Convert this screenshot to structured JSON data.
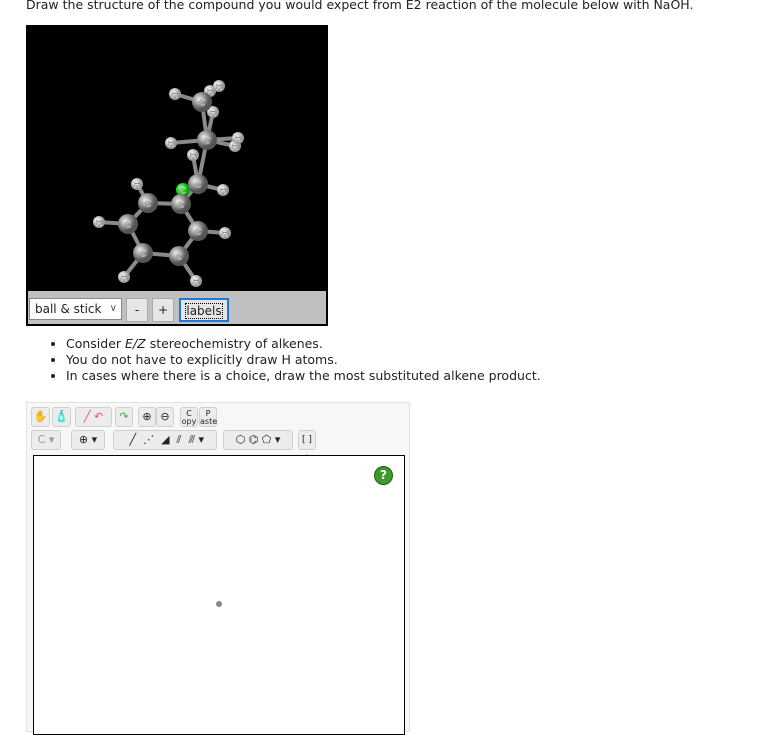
{
  "question": "Draw the structure of the compound you would expect from E2 reaction of the molecule below with NaOH.",
  "viewer": {
    "style_select": "ball & stick",
    "minus": "-",
    "plus": "+",
    "labels": "labels",
    "atom_c": "C",
    "atom_h": "H",
    "halogen_color": "#22c322"
  },
  "bullets": [
    {
      "pre": "Consider ",
      "em": "E/Z",
      "post": " stereochemistry of alkenes."
    },
    {
      "pre": "You do not have to explicitly draw H atoms.",
      "em": "",
      "post": ""
    },
    {
      "pre": "In cases where there is a choice, draw the most substituted alkene product.",
      "em": "",
      "post": ""
    }
  ],
  "editor": {
    "tools_row1": [
      "hand-icon",
      "erase-bottle-icon",
      "eraser-icon",
      "undo-icon",
      "redo-icon",
      "zoom-in-icon",
      "zoom-out-icon"
    ],
    "copy": "C",
    "copy_sub": "opy",
    "paste": "P",
    "paste_sub": "aste",
    "element": "C",
    "charge": "⊕",
    "bracket": "[ ]±",
    "help": "?"
  }
}
